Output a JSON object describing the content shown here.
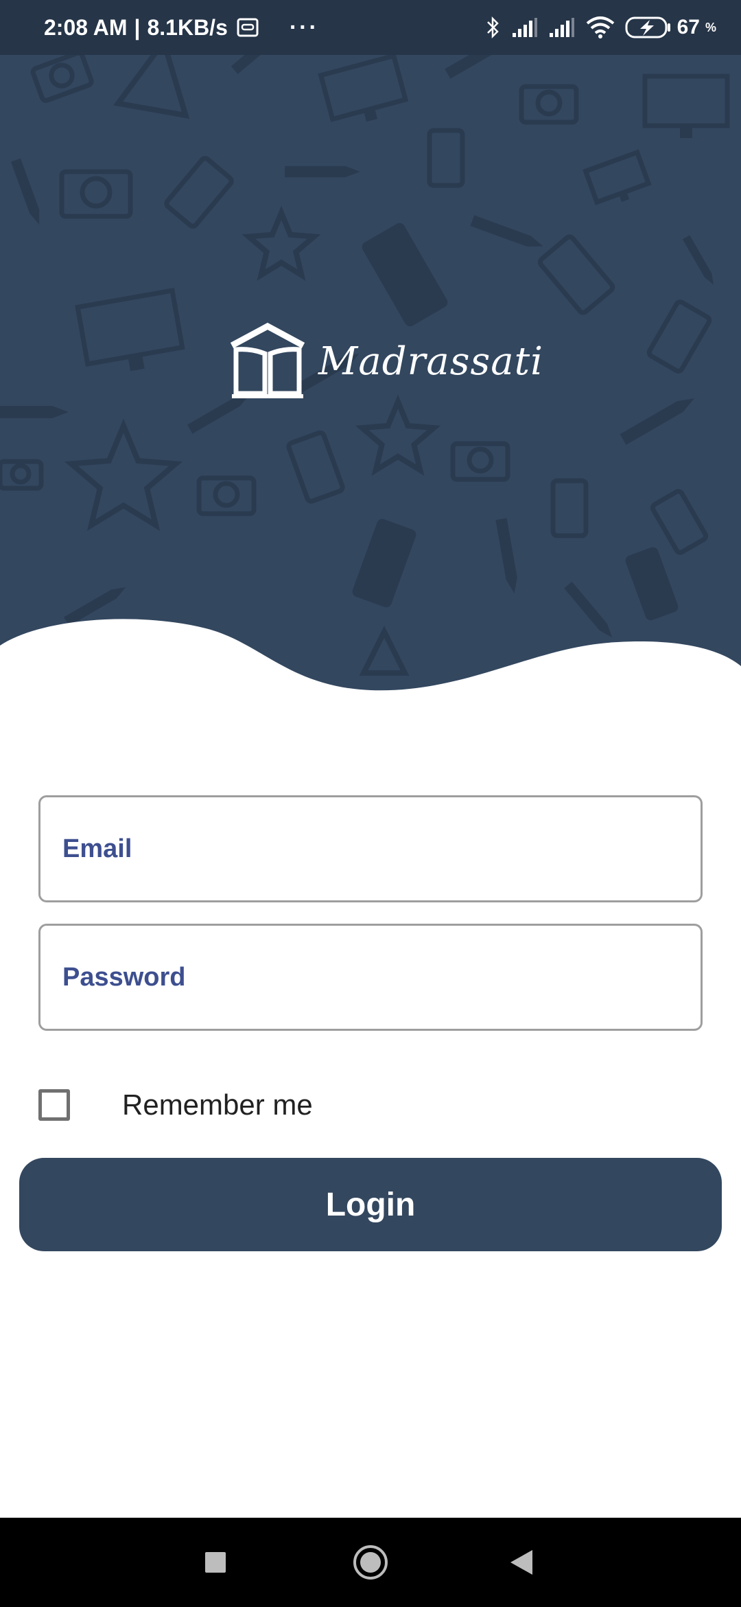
{
  "status_bar": {
    "time": "2:08 AM",
    "separator": "|",
    "network_speed": "8.1KB/s",
    "more": "···",
    "battery_level": "67",
    "battery_unit": "%",
    "icons": [
      "screen-record-icon",
      "bluetooth-icon",
      "signal-icon",
      "signal-icon",
      "wifi-icon",
      "battery-charging-icon"
    ]
  },
  "brand": {
    "name": "Madrassati",
    "icon": "book-house-logo"
  },
  "form": {
    "email_placeholder": "Email",
    "password_placeholder": "Password",
    "remember_label": "Remember me",
    "remember_checked": false,
    "login_label": "Login"
  },
  "colors": {
    "primary": "#33475f",
    "status_bar": "#263548",
    "field_text": "#3d4f8f"
  },
  "nav_bar": {
    "icons": [
      "recent-apps-icon",
      "home-icon",
      "back-icon"
    ]
  }
}
